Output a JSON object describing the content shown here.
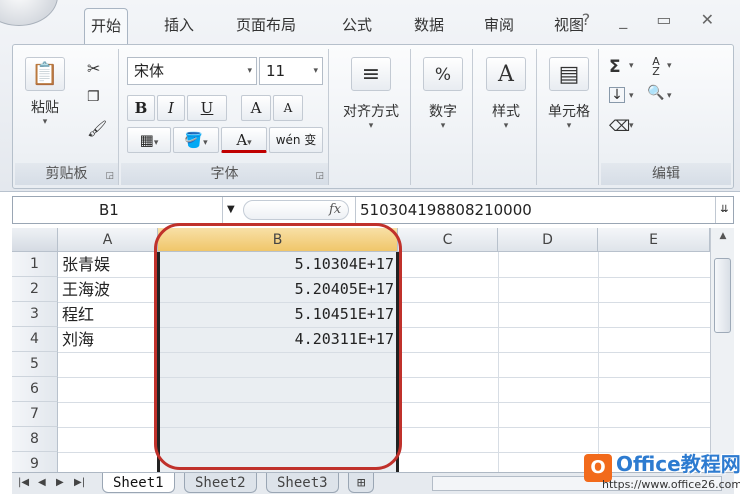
{
  "ribbon": {
    "tabs": [
      "开始",
      "插入",
      "页面布局",
      "公式",
      "数据",
      "审阅",
      "视图"
    ],
    "active_tab": "开始",
    "window_controls": "? _ ▭ ✕",
    "clipboard": {
      "paste_label": "粘贴",
      "group_label": "剪贴板"
    },
    "font": {
      "font_name": "宋体",
      "font_size": "11",
      "bold": "B",
      "italic": "I",
      "underline": "U",
      "grow": "A",
      "shrink": "A",
      "font_color": "A",
      "phonetic": "wén 变",
      "group_label": "字体"
    },
    "alignment_label": "对齐方式",
    "number": {
      "symbol": "%",
      "label": "数字"
    },
    "styles_label": "样式",
    "cells_label": "单元格",
    "editing": {
      "sum": "Σ",
      "sort": "A Z",
      "find": "🔍",
      "group_label": "编辑"
    }
  },
  "formula_bar": {
    "name_box": "B1",
    "fx": "fx",
    "value": "510304198808210000"
  },
  "grid": {
    "columns": [
      "A",
      "B",
      "C",
      "D",
      "E"
    ],
    "row_numbers": [
      "1",
      "2",
      "3",
      "4",
      "5",
      "6",
      "7",
      "8",
      "9"
    ],
    "rows": [
      {
        "a": "张青娱",
        "b": "5.10304E+17"
      },
      {
        "a": "王海波",
        "b": "5.20405E+17"
      },
      {
        "a": "程红",
        "b": "5.10451E+17"
      },
      {
        "a": "刘海",
        "b": "4.20311E+17"
      }
    ]
  },
  "sheets": {
    "tabs": [
      "Sheet1",
      "Sheet2",
      "Sheet3"
    ],
    "active": "Sheet1"
  },
  "watermark": {
    "logo": "O",
    "title": "Office教程网",
    "url": "https://www.office26.com"
  },
  "colors": {
    "highlight": "#c0312b",
    "selected_header": "#f0c66a",
    "watermark_orange": "#f26a1b",
    "watermark_blue": "#2d7bd0"
  }
}
